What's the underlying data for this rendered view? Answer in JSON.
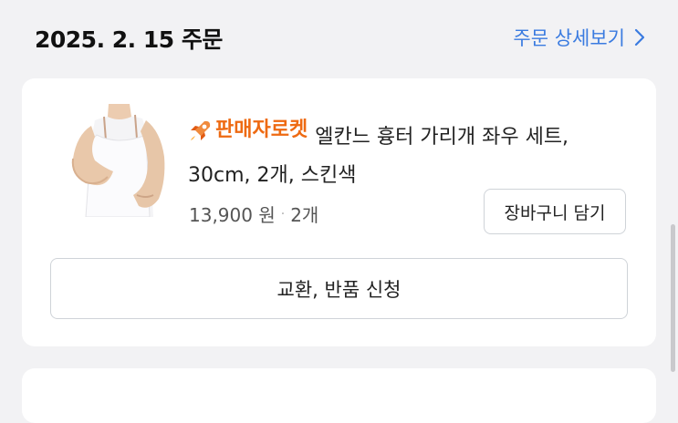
{
  "header": {
    "order_date": "2025. 2. 15 주문",
    "detail_link": "주문 상세보기"
  },
  "order_item": {
    "badge_label": "판매자로켓",
    "product_name": "엘칸느 흉터 가리개 좌우 세트, 30cm, 2개, 스킨색",
    "price": "13,900 원",
    "separator": "·",
    "quantity": "2개",
    "cart_button": "장바구니 담기",
    "return_button": "교환, 반품 신청"
  },
  "colors": {
    "accent_link": "#3a7be0",
    "badge": "#ee6a12",
    "background": "#f2f2f4"
  },
  "icons": {
    "badge_icon": "rocket-icon",
    "link_icon": "chevron-right-icon"
  }
}
